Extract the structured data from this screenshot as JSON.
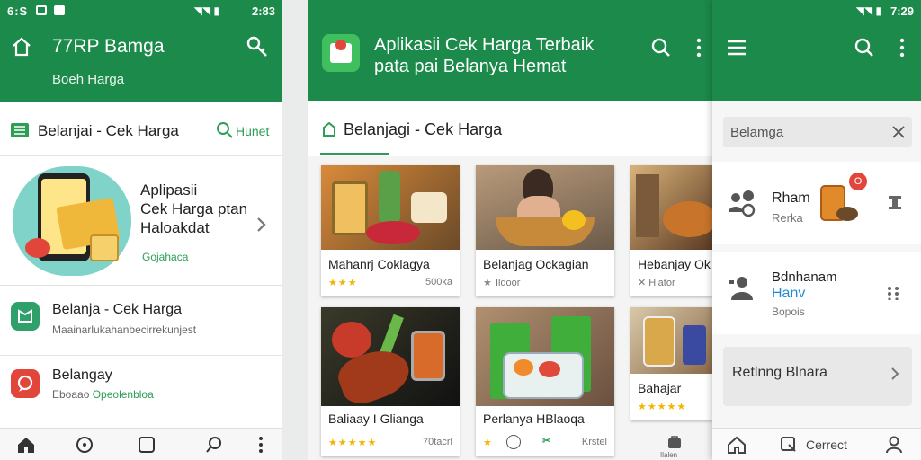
{
  "colors": {
    "primary": "#1c8a4a",
    "accent": "#2e9e57",
    "star": "#f1b700",
    "red": "#e2463b"
  },
  "screen1": {
    "status_left": "6:S",
    "status_right": "2:83",
    "app_title": "77RP Bamga",
    "app_subtitle": "Boeh Harga",
    "section_title": "Belanjai - Cek Harga",
    "section_action": "Hunet",
    "promo": {
      "line1": "Aplipasii",
      "line2": "Cek Harga ptan",
      "line3": "Haloakdat",
      "link": "Gojahaca"
    },
    "items": [
      {
        "title": "Belanja - Cek Harga",
        "subtitle": "Maainarlukahanbecirrekunjest",
        "badge": "🛍",
        "color": "#2fa06a"
      },
      {
        "title": "Belangay",
        "subtitle": "Eboaao",
        "subtitle_accent": "Opeolenbloa",
        "badge": "◎",
        "color": "#e2463b"
      }
    ],
    "nav_icons": [
      "home-icon",
      "smile-icon",
      "square-icon",
      "search-icon",
      "more-icon"
    ]
  },
  "screen2": {
    "header_line1": "Aplikasii Cek Harga Terbaik",
    "header_line2": "pata pai Belanya Hemat",
    "section_title": "Belanjagi - Cek Harga",
    "cards": [
      {
        "title": "Mahanrj Coklagya",
        "stars": "★★★",
        "right": "500ka"
      },
      {
        "title": "Belanjag Ockagian",
        "stars": "★",
        "right": "",
        "sub": "Ildoor"
      },
      {
        "title": "Hebanjay Ok",
        "stars": "✕",
        "sub": "Hiator"
      },
      {
        "title": "Baliaay I Glianga",
        "stars": "★★★★★",
        "right": "70tacrl"
      },
      {
        "title": "Perlanya HBlaoqa",
        "stars": "",
        "right": "Krstel"
      },
      {
        "title": "Bahajar",
        "stars": "★★★★★",
        "right": ""
      }
    ],
    "fab_label": "Ilalen"
  },
  "screen3": {
    "status_right": "7:29",
    "search_value": "Belamga",
    "items": [
      {
        "title": "Rham",
        "subtitle": "Rerka",
        "badge": "O"
      },
      {
        "title": "Bdnhanam",
        "accent": "Hanv",
        "subtitle": "Bopois"
      }
    ],
    "row_button": "Retlnng Blnara",
    "nav": {
      "center_label": "Cerrect"
    }
  }
}
